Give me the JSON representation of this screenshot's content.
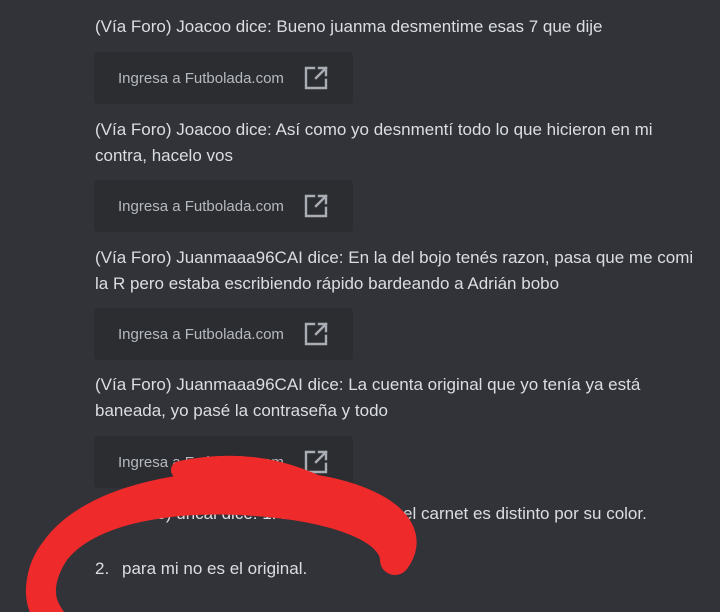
{
  "messages": [
    {
      "text": "(Vía Foro) Joacoo dice: Bueno juanma desmentime esas 7 que dije"
    },
    {
      "text": "(Vía Foro) Joacoo dice: Así como yo desnmentí todo lo que hicieron en mi contra, hacelo vos"
    },
    {
      "text": "(Vía Foro) Juanmaaa96CAI dice: En la del bojo tenés razon, pasa que me comi la R pero estaba escribiendo rápido bardeando a Adrián bobo"
    },
    {
      "text": "(Vía Foro) Juanmaaa96CAI dice: La cuenta original que yo tenía ya está baneada, yo pasé la contraseña y todo"
    },
    {
      "text": "(Vía Foro) urical dice: 1. ... nada, ya que el carnet es distinto por su color."
    }
  ],
  "embeds": [
    {
      "label": "Ingresa a Futbolada.com",
      "icon": "external-link-icon"
    },
    {
      "label": "Ingresa a Futbolada.com",
      "icon": "external-link-icon"
    },
    {
      "label": "Ingresa a Futbolada.com",
      "icon": "external-link-icon"
    },
    {
      "label": "Ingresa a Futbolada.com",
      "icon": "external-link-icon"
    }
  ],
  "list_item": {
    "number": "2.",
    "text": "para mi no es el original."
  },
  "colors": {
    "background": "#313338",
    "embed_background": "#2b2d31",
    "text": "#dbdee1",
    "muted_text": "#b5bac1",
    "annotation": "#ee2a2a"
  }
}
